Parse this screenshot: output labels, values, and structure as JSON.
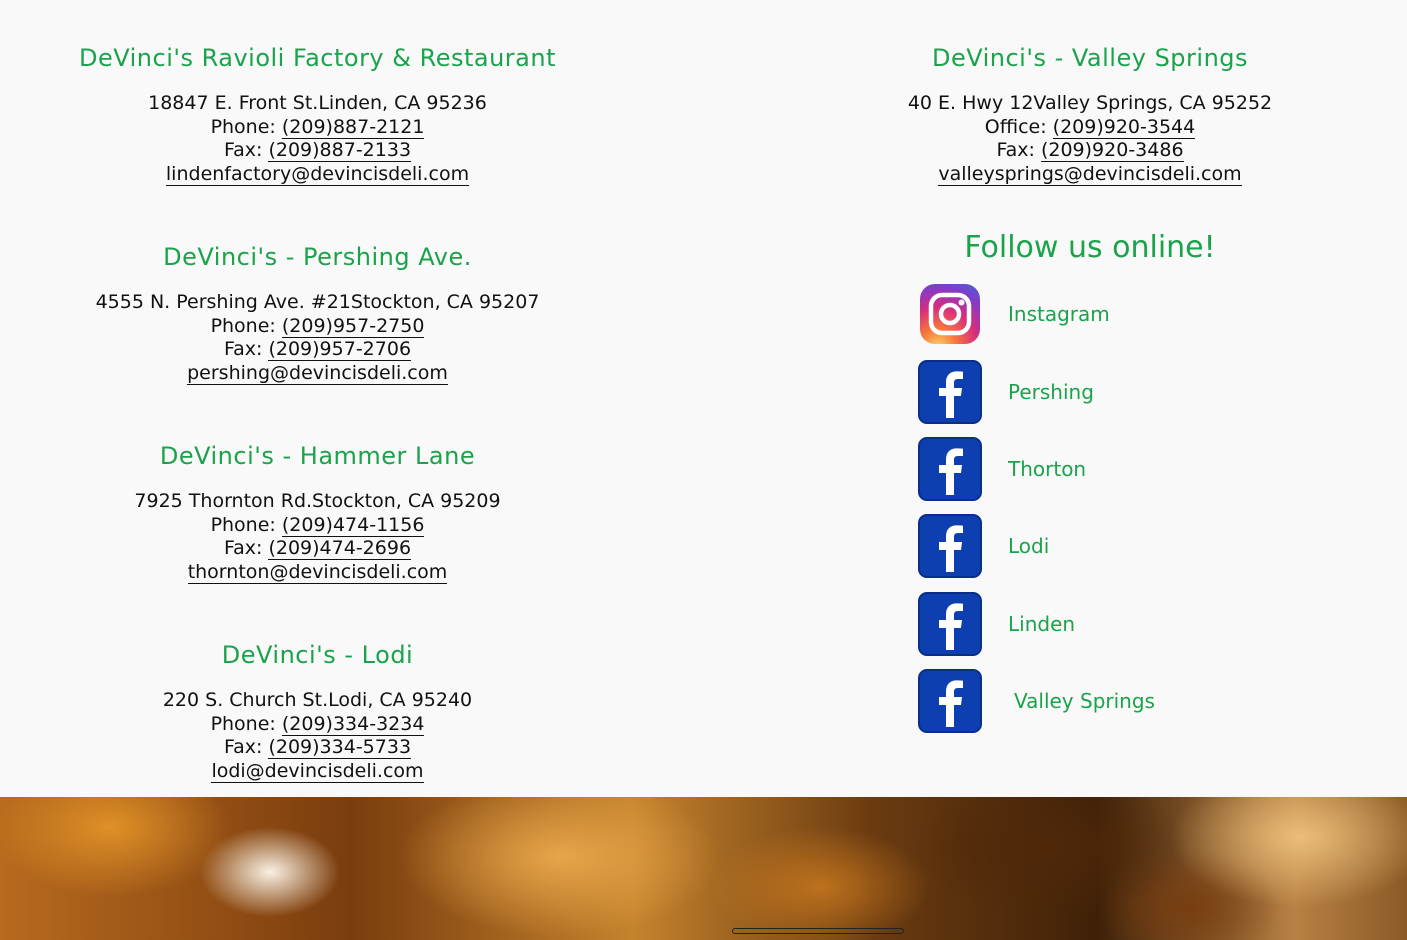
{
  "locations_left": [
    {
      "title": "DeVinci's Ravioli Factory & Restaurant",
      "address": "18847 E. Front St.Linden, CA 95236",
      "line2_label": "Phone: ",
      "line2_value": "(209)887-2121",
      "fax_label": "Fax: ",
      "fax_value": "(209)887-2133",
      "email": "lindenfactory@devincisdeli.com"
    },
    {
      "title": "DeVinci's - Pershing Ave.",
      "address": "4555 N. Pershing Ave. #21Stockton, CA 95207",
      "line2_label": "Phone: ",
      "line2_value": "(209)957-2750",
      "fax_label": "Fax: ",
      "fax_value": "(209)957-2706",
      "email": "pershing@devincisdeli.com"
    },
    {
      "title": "DeVinci's - Hammer Lane",
      "address": "7925 Thornton Rd.Stockton, CA 95209",
      "line2_label": "Phone: ",
      "line2_value": "(209)474-1156",
      "fax_label": "Fax: ",
      "fax_value": "(209)474-2696",
      "email": "thornton@devincisdeli.com"
    },
    {
      "title": "DeVinci's - Lodi",
      "address": "220 S. Church St.Lodi, CA 95240",
      "line2_label": "Phone: ",
      "line2_value": "(209)334-3234",
      "fax_label": "Fax: ",
      "fax_value": "(209)334-5733",
      "email": "lodi@devincisdeli.com"
    }
  ],
  "location_right": {
    "title": "DeVinci's - Valley Springs",
    "address": "40 E. Hwy 12Valley Springs, CA 95252",
    "line2_label": "Office: ",
    "line2_value": "(209)920-3544",
    "fax_label": "Fax: ",
    "fax_value": "(209)920-3486",
    "email": "valleysprings@devincisdeli.com"
  },
  "follow": {
    "title": "Follow us online!",
    "links": [
      {
        "label": "Instagram",
        "icon": "instagram-icon"
      },
      {
        "label": "Pershing",
        "icon": "facebook-icon"
      },
      {
        "label": "Thorton",
        "icon": "facebook-icon"
      },
      {
        "label": "Lodi",
        "icon": "facebook-icon"
      },
      {
        "label": "Linden",
        "icon": "facebook-icon"
      },
      {
        "label": "Valley Springs",
        "icon": "facebook-icon"
      }
    ]
  },
  "colors": {
    "accent_green": "#1aa34a",
    "facebook_blue": "#0d3fb0",
    "text": "#111111",
    "background": "#f9f9f9"
  }
}
